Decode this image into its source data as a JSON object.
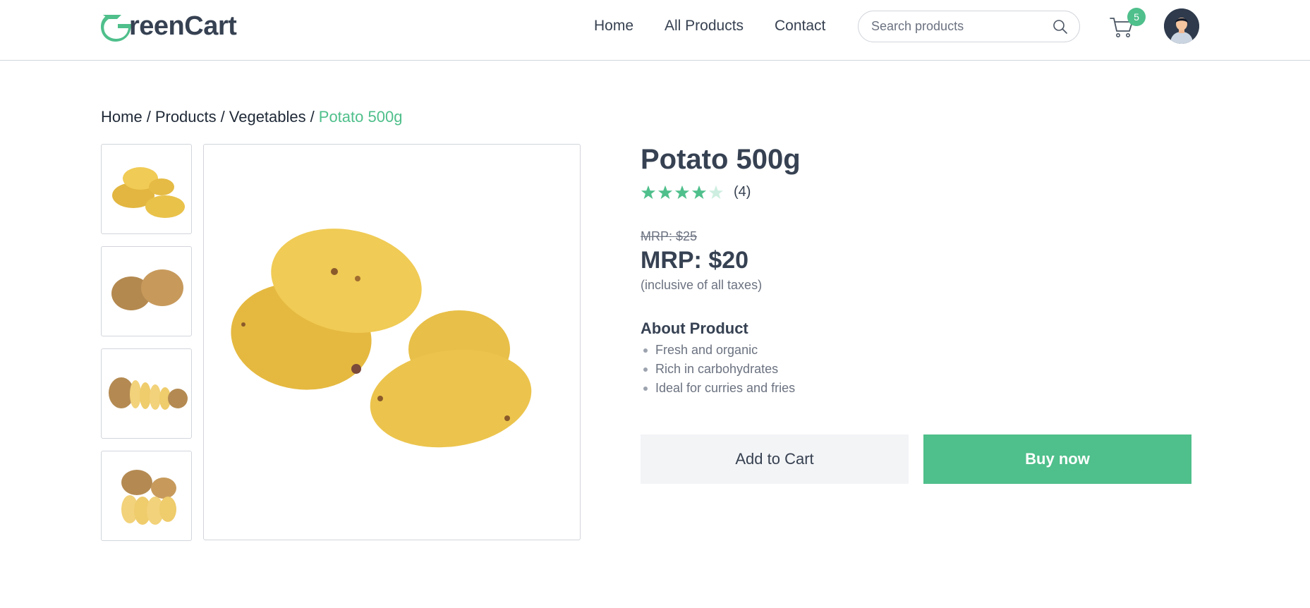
{
  "header": {
    "logo_text": "reenCart",
    "nav": [
      "Home",
      "All Products",
      "Contact"
    ],
    "search_placeholder": "Search products",
    "cart_count": "5",
    "icons": {
      "search": "search-icon",
      "cart": "cart-icon",
      "avatar": "user-avatar"
    }
  },
  "breadcrumb": {
    "items": [
      "Home",
      "Products",
      "Vegetables"
    ],
    "current": "Potato 500g"
  },
  "gallery": {
    "thumbnails": [
      "potato-pile",
      "potato-two",
      "potato-sliced",
      "potato-halved"
    ],
    "selected": "potato-pile"
  },
  "product": {
    "title": "Potato 500g",
    "rating": 4,
    "rating_max": 5,
    "rating_count": "(4)",
    "old_price": "MRP: $25",
    "price": "MRP: $20",
    "tax_note": "(inclusive of all taxes)",
    "about_title": "About Product",
    "about_items": [
      "Fresh and organic",
      "Rich in carbohydrates",
      "Ideal for curries and fries"
    ]
  },
  "actions": {
    "add_to_cart": "Add to Cart",
    "buy_now": "Buy now"
  },
  "colors": {
    "accent": "#4fbf8b",
    "text_dark": "#364152",
    "muted": "#6b7280",
    "border": "#d1d5db"
  }
}
